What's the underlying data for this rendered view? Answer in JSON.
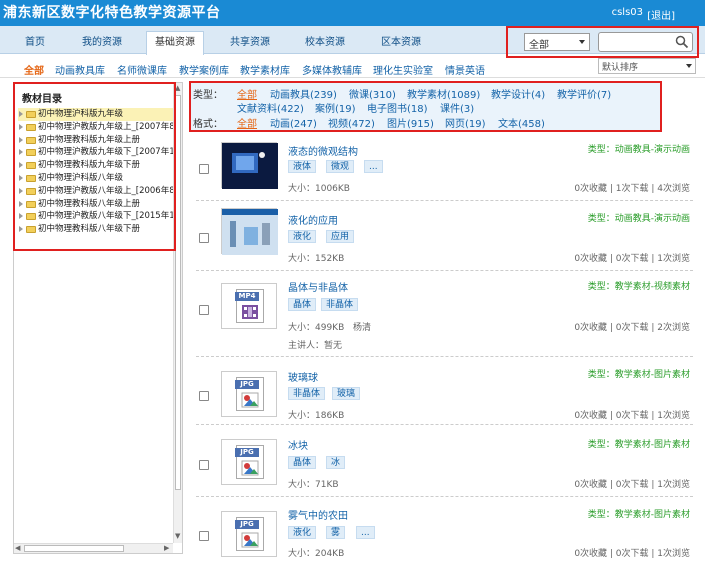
{
  "header": {
    "title": "浦东新区数字化特色教学资源平台",
    "username": "csls03",
    "logout_label": "[退出]",
    "brand_color": "#1a8ad4"
  },
  "nav": {
    "tabs": [
      {
        "label": "首页"
      },
      {
        "label": "我的资源"
      },
      {
        "label": "基础资源",
        "active": true
      },
      {
        "label": "共享资源"
      },
      {
        "label": "校本资源"
      },
      {
        "label": "区本资源"
      }
    ]
  },
  "search": {
    "scope_value": "全部",
    "query": "",
    "icon": "search-icon"
  },
  "subnav": {
    "items": [
      {
        "label": "全部",
        "active": true
      },
      {
        "label": "动画教具库"
      },
      {
        "label": "名师微课库"
      },
      {
        "label": "教学案例库"
      },
      {
        "label": "教学素材库"
      },
      {
        "label": "多媒体教辅库"
      },
      {
        "label": "理化生实验室"
      },
      {
        "label": "情景英语"
      }
    ],
    "sort_value": "默认排序"
  },
  "sidebar": {
    "title": "教材目录",
    "tree": [
      {
        "label": "初中物理沪科版九年级",
        "selected": true
      },
      {
        "label": "初中物理沪教版九年级上_[2007年8"
      },
      {
        "label": "初中物理教科版九年级上册"
      },
      {
        "label": "初中物理沪教版九年级下_[2007年1"
      },
      {
        "label": "初中物理教科版九年级下册"
      },
      {
        "label": "初中物理沪科版八年级"
      },
      {
        "label": "初中物理沪教版八年级上_[2006年8"
      },
      {
        "label": "初中物理教科版八年级上册"
      },
      {
        "label": "初中物理沪教版八年级下_[2015年1"
      },
      {
        "label": "初中物理教科版八年级下册"
      }
    ]
  },
  "filters": {
    "type_label": "类型：",
    "type_items": [
      {
        "label": "全部",
        "active": true
      },
      {
        "label": "动画教具(239)"
      },
      {
        "label": "微课(310)"
      },
      {
        "label": "教学素材(1089)"
      },
      {
        "label": "教学设计(4)"
      },
      {
        "label": "教学评价(7)"
      },
      {
        "label": "文献资料(422)"
      },
      {
        "label": "案例(19)"
      },
      {
        "label": "电子图书(18)"
      },
      {
        "label": "课件(3)"
      }
    ],
    "format_label": "格式：",
    "format_items": [
      {
        "label": "全部",
        "active": true
      },
      {
        "label": "动画(247)"
      },
      {
        "label": "视频(472)"
      },
      {
        "label": "图片(915)"
      },
      {
        "label": "网页(19)"
      },
      {
        "label": "文本(458)"
      }
    ]
  },
  "resources": [
    {
      "title": "液态的微观结构",
      "type": "类型：动画教具-演示动画",
      "tags": [
        "液体",
        "微观",
        "..."
      ],
      "size": "大小：1006KB",
      "stats": "0次收藏 | 1次下载 | 4次浏览",
      "thumb": "screenshot"
    },
    {
      "title": "液化的应用",
      "type": "类型：动画教具-演示动画",
      "tags": [
        "液化",
        "应用"
      ],
      "size": "大小：152KB",
      "stats": "0次收藏 | 0次下载 | 1次浏览",
      "thumb": "screenshot"
    },
    {
      "title": "晶体与非晶体",
      "type": "类型：教学素材-视频素材",
      "tags": [
        "晶体",
        "非晶体"
      ],
      "size": "大小：499KB",
      "author": "杨清",
      "speaker": "主讲人：暂无",
      "stats": "0次收藏 | 0次下载 | 2次浏览",
      "thumb": "MP4"
    },
    {
      "title": "玻璃球",
      "type": "类型：教学素材-图片素材",
      "tags": [
        "非晶体",
        "玻璃"
      ],
      "size": "大小：186KB",
      "stats": "0次收藏 | 0次下载 | 1次浏览",
      "thumb": "JPG"
    },
    {
      "title": "冰块",
      "type": "类型：教学素材-图片素材",
      "tags": [
        "晶体",
        "冰"
      ],
      "size": "大小：71KB",
      "stats": "0次收藏 | 0次下载 | 1次浏览",
      "thumb": "JPG"
    },
    {
      "title": "雾气中的农田",
      "type": "类型：教学素材-图片素材",
      "tags": [
        "液化",
        "雾",
        "..."
      ],
      "size": "大小：204KB",
      "stats": "0次收藏 | 0次下载 | 1次浏览",
      "thumb": "JPG"
    }
  ]
}
